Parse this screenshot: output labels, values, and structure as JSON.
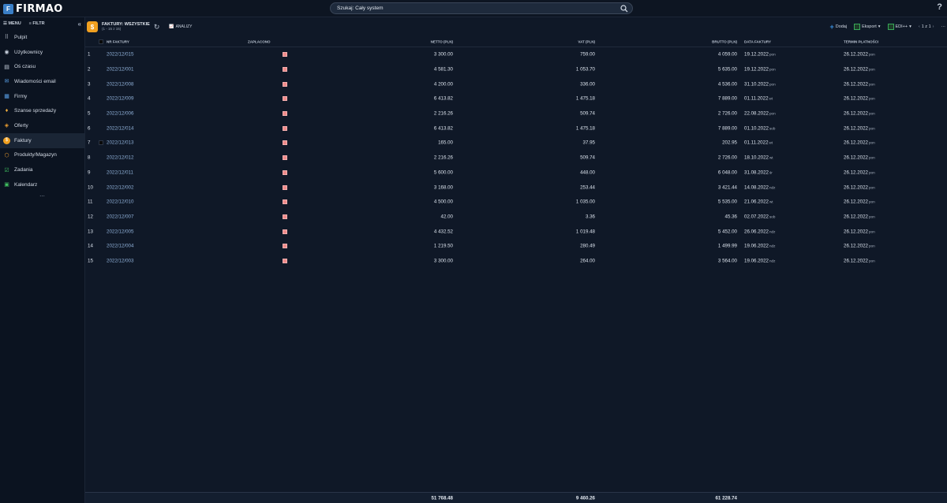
{
  "app": {
    "logo_text": "FIRMAO",
    "logo_letter": "F"
  },
  "search": {
    "text": "Szukaj: Cały system"
  },
  "help": "?",
  "sidebar": {
    "menu_label": "MENU",
    "filter_label": "FILTR",
    "collapse": "«",
    "more": "...",
    "items": [
      {
        "label": "Pulpit",
        "icon": "grid-icon",
        "glyph": "⠿",
        "color": "#c8d0dc"
      },
      {
        "label": "Użytkownicy",
        "icon": "user-icon",
        "glyph": "◉",
        "color": "#c8d0dc"
      },
      {
        "label": "Oś czasu",
        "icon": "timeline-icon",
        "glyph": "▤",
        "color": "#c8d0dc"
      },
      {
        "label": "Wiadomości email",
        "icon": "mail-icon",
        "glyph": "✉",
        "color": "#5aa0e8"
      },
      {
        "label": "Firmy",
        "icon": "building-icon",
        "glyph": "▦",
        "color": "#5aa0e8"
      },
      {
        "label": "Szanse sprzedaży",
        "icon": "moneybag-icon",
        "glyph": "♦",
        "color": "#f0b040"
      },
      {
        "label": "Oferty",
        "icon": "tag-icon",
        "glyph": "◈",
        "color": "#f0a030"
      },
      {
        "label": "Faktury",
        "icon": "invoice-icon",
        "glyph": "$",
        "color": "#f0a020"
      },
      {
        "label": "Produkty/Magazyn",
        "icon": "box-icon",
        "glyph": "⬡",
        "color": "#f0a030"
      },
      {
        "label": "Zadania",
        "icon": "checkbox-icon",
        "glyph": "☑",
        "color": "#40c060"
      },
      {
        "label": "Kalendarz",
        "icon": "calendar-icon",
        "glyph": "▣",
        "color": "#40c060"
      }
    ],
    "active_index": 7
  },
  "toolbar": {
    "title": "FAKTURY: WSZYSTKIE",
    "subtitle": "(1 - 15 z 15)",
    "analizy": "ANALIZY",
    "add": "Dodaj",
    "export": "Eksport",
    "edi": "EDI++",
    "pager": "1 z 1",
    "more": "···"
  },
  "table": {
    "headers": {
      "nr": "NR FAKTURY",
      "paid": "ZAPŁACONO",
      "netto": "NETTO (PLN)",
      "vat": "VAT (PLN)",
      "brutto": "BRUTTO (PLN)",
      "date": "DATA FAKTURY",
      "due": "TERMIN PŁATNOŚCI"
    },
    "rows": [
      {
        "idx": "1",
        "nr": "2022/12/015",
        "netto": "3 300.00",
        "vat": "759.00",
        "brutto": "4 059.00",
        "date": "19.12.2022",
        "day": "pon",
        "due": "26.12.2022",
        "due_day": "pon"
      },
      {
        "idx": "2",
        "nr": "2022/12/001",
        "netto": "4 581.30",
        "vat": "1 053.70",
        "brutto": "5 635.00",
        "date": "19.12.2022",
        "day": "pon",
        "due": "26.12.2022",
        "due_day": "pon"
      },
      {
        "idx": "3",
        "nr": "2022/12/008",
        "netto": "4 200.00",
        "vat": "336.00",
        "brutto": "4 536.00",
        "date": "31.10.2022",
        "day": "pon",
        "due": "26.12.2022",
        "due_day": "pon"
      },
      {
        "idx": "4",
        "nr": "2022/12/009",
        "netto": "6 413.82",
        "vat": "1 475.18",
        "brutto": "7 889.00",
        "date": "01.11.2022",
        "day": "wt",
        "due": "26.12.2022",
        "due_day": "pon"
      },
      {
        "idx": "5",
        "nr": "2022/12/006",
        "netto": "2 216.26",
        "vat": "509.74",
        "brutto": "2 726.00",
        "date": "22.08.2022",
        "day": "pon",
        "due": "26.12.2022",
        "due_day": "pon"
      },
      {
        "idx": "6",
        "nr": "2022/12/014",
        "netto": "6 413.82",
        "vat": "1 475.18",
        "brutto": "7 889.00",
        "date": "01.10.2022",
        "day": "sob",
        "due": "26.12.2022",
        "due_day": "pon"
      },
      {
        "idx": "7",
        "nr": "2022/12/013",
        "netto": "165.00",
        "vat": "37.95",
        "brutto": "202.95",
        "date": "01.11.2022",
        "day": "wt",
        "due": "26.12.2022",
        "due_day": "pon"
      },
      {
        "idx": "8",
        "nr": "2022/12/012",
        "netto": "2 216.26",
        "vat": "509.74",
        "brutto": "2 726.00",
        "date": "18.10.2022",
        "day": "wt",
        "due": "26.12.2022",
        "due_day": "pon"
      },
      {
        "idx": "9",
        "nr": "2022/12/011",
        "netto": "5 600.00",
        "vat": "448.00",
        "brutto": "6 048.00",
        "date": "31.08.2022",
        "day": "śr",
        "due": "26.12.2022",
        "due_day": "pon"
      },
      {
        "idx": "10",
        "nr": "2022/12/002",
        "netto": "3 168.00",
        "vat": "253.44",
        "brutto": "3 421.44",
        "date": "14.08.2022",
        "day": "ndz",
        "due": "26.12.2022",
        "due_day": "pon"
      },
      {
        "idx": "11",
        "nr": "2022/12/010",
        "netto": "4 500.00",
        "vat": "1 035.00",
        "brutto": "5 535.00",
        "date": "21.06.2022",
        "day": "wt",
        "due": "26.12.2022",
        "due_day": "pon"
      },
      {
        "idx": "12",
        "nr": "2022/12/007",
        "netto": "42.00",
        "vat": "3.36",
        "brutto": "45.36",
        "date": "02.07.2022",
        "day": "sob",
        "due": "26.12.2022",
        "due_day": "pon"
      },
      {
        "idx": "13",
        "nr": "2022/12/005",
        "netto": "4 432.52",
        "vat": "1 019.48",
        "brutto": "5 452.00",
        "date": "26.06.2022",
        "day": "ndz",
        "due": "26.12.2022",
        "due_day": "pon"
      },
      {
        "idx": "14",
        "nr": "2022/12/004",
        "netto": "1 219.50",
        "vat": "280.49",
        "brutto": "1 499.99",
        "date": "19.06.2022",
        "day": "ndz",
        "due": "26.12.2022",
        "due_day": "pon"
      },
      {
        "idx": "15",
        "nr": "2022/12/003",
        "netto": "3 300.00",
        "vat": "264.00",
        "brutto": "3 564.00",
        "date": "19.06.2022",
        "day": "ndz",
        "due": "26.12.2022",
        "due_day": "pon"
      }
    ],
    "totals": {
      "netto": "51 768.48",
      "vat": "9 460.26",
      "brutto": "61 228.74"
    }
  }
}
